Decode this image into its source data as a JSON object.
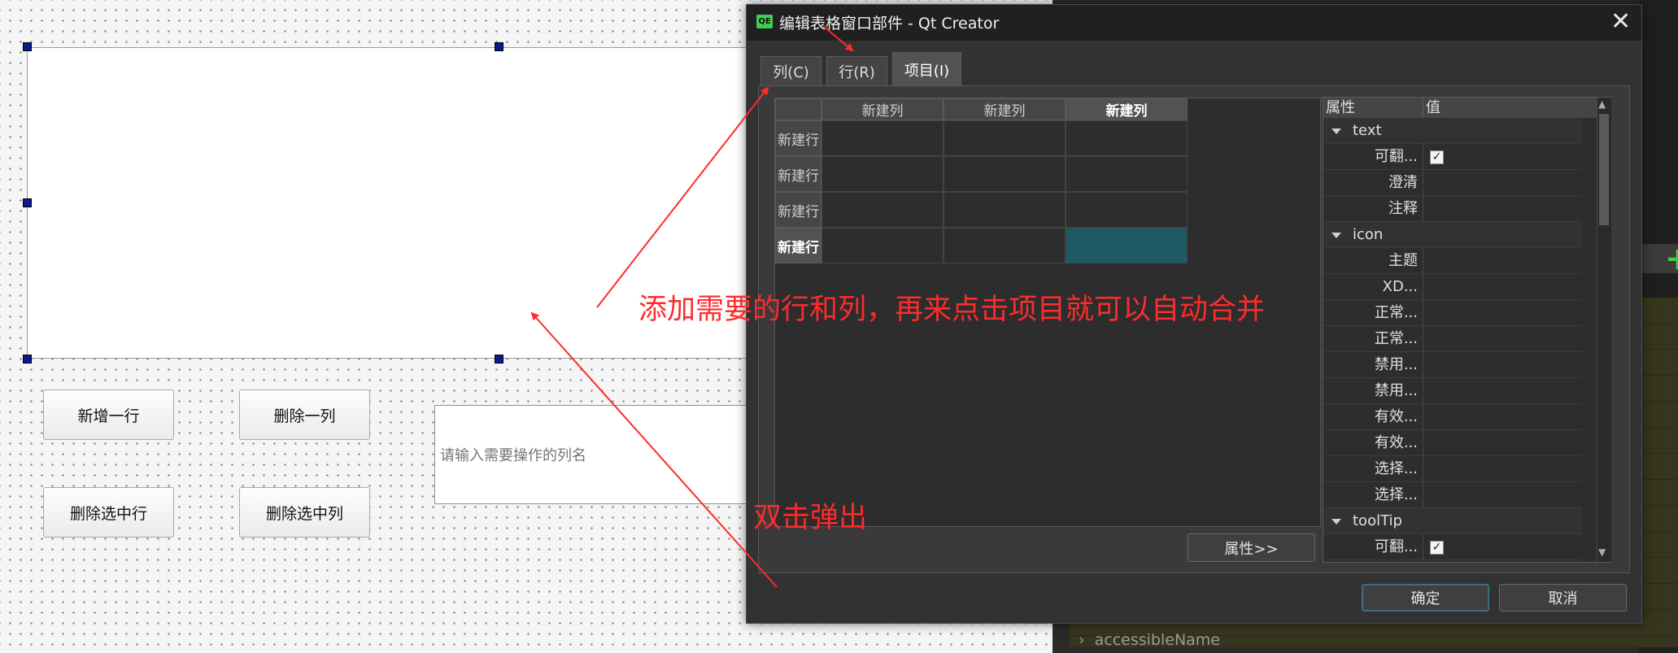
{
  "form": {
    "placeholder": "请输入需要操作的列名",
    "buttons": {
      "add_row": "新增一行",
      "delete_col": "删除一列",
      "delete_selected_row": "删除选中行",
      "delete_selected_col": "删除选中列"
    }
  },
  "ide": {
    "bottom_label": "accessibleName"
  },
  "dialog": {
    "logo": "QE",
    "title": "编辑表格窗口部件 - Qt Creator",
    "close_glyph": "✕",
    "tabs": [
      "列(C)",
      "行(R)",
      "项目(I)"
    ],
    "active_tab": "项目(I)",
    "table": {
      "columns": [
        "新建列",
        "新建列",
        "新建列"
      ],
      "rows": [
        "新建行",
        "新建行",
        "新建行",
        "新建行"
      ],
      "current_row": 4,
      "current_col": 3
    },
    "properties_button": "属性>>",
    "property_grid": {
      "headers": [
        "属性",
        "值"
      ],
      "rows": [
        {
          "label": "text",
          "group": true
        },
        {
          "label": "可翻...",
          "checked": true
        },
        {
          "label": "澄清"
        },
        {
          "label": "注释"
        },
        {
          "label": "icon",
          "group": true
        },
        {
          "label": "主题"
        },
        {
          "label": "XD..."
        },
        {
          "label": "正常..."
        },
        {
          "label": "正常..."
        },
        {
          "label": "禁用..."
        },
        {
          "label": "禁用..."
        },
        {
          "label": "有效..."
        },
        {
          "label": "有效..."
        },
        {
          "label": "选择..."
        },
        {
          "label": "选择..."
        },
        {
          "label": "toolTip",
          "group": true
        },
        {
          "label": "可翻...",
          "checked": true
        }
      ]
    },
    "ok": "确定",
    "cancel": "取消"
  },
  "annotations": {
    "main": "添加需要的行和列，再来点击项目就可以自动合并",
    "double_click": "双击弹出"
  },
  "colors": {
    "annotation": "#ff2b2b",
    "selection_handle": "#0a1a8c",
    "selected_cell": "#1d5a63"
  }
}
